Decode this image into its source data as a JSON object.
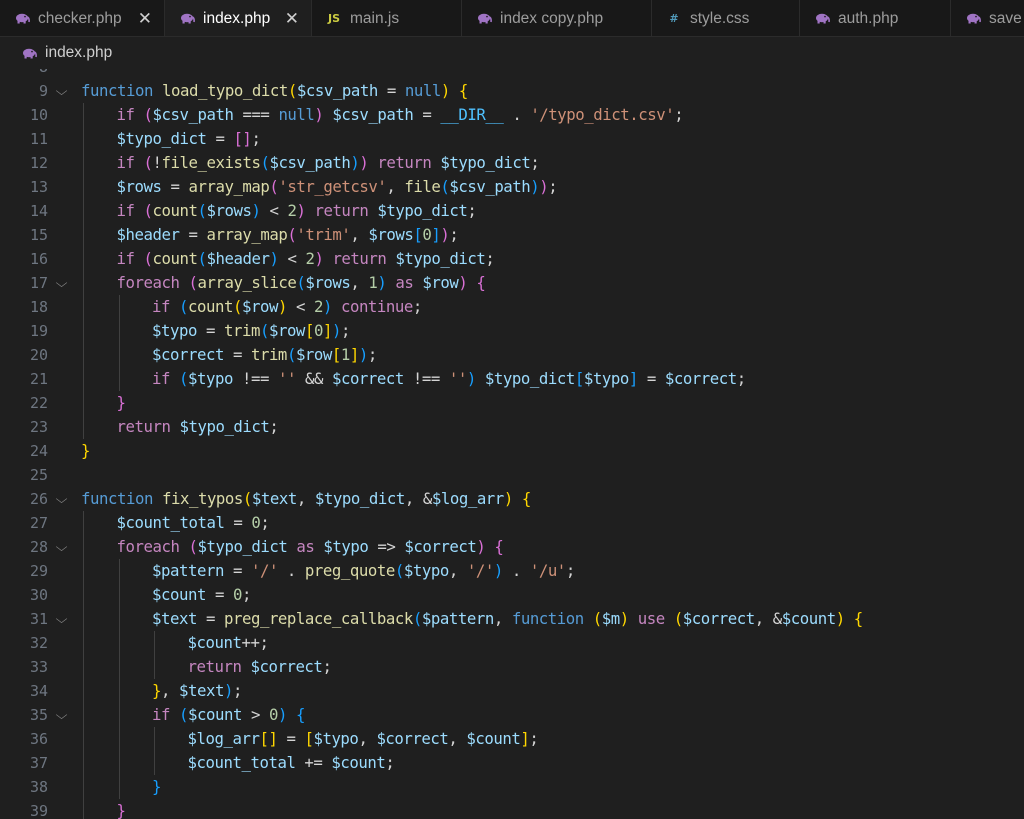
{
  "tabs": [
    {
      "label": "checker.php",
      "icon": "php-elephant-icon",
      "closable": true,
      "active": false
    },
    {
      "label": "index.php",
      "icon": "php-elephant-icon",
      "closable": true,
      "active": true
    },
    {
      "label": "main.js",
      "icon": "js-icon",
      "icon_text": "JS",
      "active": false
    },
    {
      "label": "index copy.php",
      "icon": "php-elephant-icon",
      "active": false
    },
    {
      "label": "style.css",
      "icon": "css-hash-icon",
      "icon_text": "#",
      "active": false
    },
    {
      "label": "auth.php",
      "icon": "php-elephant-icon",
      "active": false
    },
    {
      "label": "save",
      "icon": "php-elephant-icon",
      "active": false
    }
  ],
  "breadcrumb": {
    "file": "index.php",
    "icon": "php-elephant-icon"
  },
  "colors": {
    "editor_bg": "#1f1f1f",
    "tabbar_bg": "#181818",
    "keyword": "#c586c0",
    "storage": "#569cd6",
    "function": "#dcdcaa",
    "variable": "#9cdcfe",
    "string": "#ce9178",
    "number": "#b5cea8",
    "bracket1": "#ffd700",
    "bracket2": "#da70d6",
    "bracket3": "#179fff"
  },
  "code_lines": [
    {
      "n": "8",
      "fold": false,
      "indent": 0,
      "tokens": []
    },
    {
      "n": "9",
      "fold": true,
      "indent": 0,
      "tokens": [
        [
          "kwb",
          "function"
        ],
        [
          "op",
          " "
        ],
        [
          "fn",
          "load_typo_dict"
        ],
        [
          "bk1",
          "("
        ],
        [
          "var",
          "$csv_path"
        ],
        [
          "op",
          " = "
        ],
        [
          "kwb",
          "null"
        ],
        [
          "bk1",
          ")"
        ],
        [
          "op",
          " "
        ],
        [
          "bk1",
          "{"
        ]
      ]
    },
    {
      "n": "10",
      "fold": false,
      "indent": 1,
      "tokens": [
        [
          "kw",
          "if"
        ],
        [
          "op",
          " "
        ],
        [
          "bk2",
          "("
        ],
        [
          "var",
          "$csv_path"
        ],
        [
          "op",
          " === "
        ],
        [
          "kwb",
          "null"
        ],
        [
          "bk2",
          ")"
        ],
        [
          "op",
          " "
        ],
        [
          "var",
          "$csv_path"
        ],
        [
          "op",
          " = "
        ],
        [
          "cst",
          "__DIR__"
        ],
        [
          "op",
          " . "
        ],
        [
          "str",
          "'/typo_dict.csv'"
        ],
        [
          "op",
          ";"
        ]
      ]
    },
    {
      "n": "11",
      "fold": false,
      "indent": 1,
      "tokens": [
        [
          "var",
          "$typo_dict"
        ],
        [
          "op",
          " = "
        ],
        [
          "bk2",
          "[]"
        ],
        [
          "op",
          ";"
        ]
      ]
    },
    {
      "n": "12",
      "fold": false,
      "indent": 1,
      "tokens": [
        [
          "kw",
          "if"
        ],
        [
          "op",
          " "
        ],
        [
          "bk2",
          "("
        ],
        [
          "op",
          "!"
        ],
        [
          "fn",
          "file_exists"
        ],
        [
          "bk3",
          "("
        ],
        [
          "var",
          "$csv_path"
        ],
        [
          "bk3",
          ")"
        ],
        [
          "bk2",
          ")"
        ],
        [
          "op",
          " "
        ],
        [
          "kw",
          "return"
        ],
        [
          "op",
          " "
        ],
        [
          "var",
          "$typo_dict"
        ],
        [
          "op",
          ";"
        ]
      ]
    },
    {
      "n": "13",
      "fold": false,
      "indent": 1,
      "tokens": [
        [
          "var",
          "$rows"
        ],
        [
          "op",
          " = "
        ],
        [
          "fn",
          "array_map"
        ],
        [
          "bk2",
          "("
        ],
        [
          "str",
          "'str_getcsv'"
        ],
        [
          "op",
          ", "
        ],
        [
          "fn",
          "file"
        ],
        [
          "bk3",
          "("
        ],
        [
          "var",
          "$csv_path"
        ],
        [
          "bk3",
          ")"
        ],
        [
          "bk2",
          ")"
        ],
        [
          "op",
          ";"
        ]
      ]
    },
    {
      "n": "14",
      "fold": false,
      "indent": 1,
      "tokens": [
        [
          "kw",
          "if"
        ],
        [
          "op",
          " "
        ],
        [
          "bk2",
          "("
        ],
        [
          "fn",
          "count"
        ],
        [
          "bk3",
          "("
        ],
        [
          "var",
          "$rows"
        ],
        [
          "bk3",
          ")"
        ],
        [
          "op",
          " < "
        ],
        [
          "num",
          "2"
        ],
        [
          "bk2",
          ")"
        ],
        [
          "op",
          " "
        ],
        [
          "kw",
          "return"
        ],
        [
          "op",
          " "
        ],
        [
          "var",
          "$typo_dict"
        ],
        [
          "op",
          ";"
        ]
      ]
    },
    {
      "n": "15",
      "fold": false,
      "indent": 1,
      "tokens": [
        [
          "var",
          "$header"
        ],
        [
          "op",
          " = "
        ],
        [
          "fn",
          "array_map"
        ],
        [
          "bk2",
          "("
        ],
        [
          "str",
          "'trim'"
        ],
        [
          "op",
          ", "
        ],
        [
          "var",
          "$rows"
        ],
        [
          "bk3",
          "["
        ],
        [
          "num",
          "0"
        ],
        [
          "bk3",
          "]"
        ],
        [
          "bk2",
          ")"
        ],
        [
          "op",
          ";"
        ]
      ]
    },
    {
      "n": "16",
      "fold": false,
      "indent": 1,
      "tokens": [
        [
          "kw",
          "if"
        ],
        [
          "op",
          " "
        ],
        [
          "bk2",
          "("
        ],
        [
          "fn",
          "count"
        ],
        [
          "bk3",
          "("
        ],
        [
          "var",
          "$header"
        ],
        [
          "bk3",
          ")"
        ],
        [
          "op",
          " < "
        ],
        [
          "num",
          "2"
        ],
        [
          "bk2",
          ")"
        ],
        [
          "op",
          " "
        ],
        [
          "kw",
          "return"
        ],
        [
          "op",
          " "
        ],
        [
          "var",
          "$typo_dict"
        ],
        [
          "op",
          ";"
        ]
      ]
    },
    {
      "n": "17",
      "fold": true,
      "indent": 1,
      "tokens": [
        [
          "kw",
          "foreach"
        ],
        [
          "op",
          " "
        ],
        [
          "bk2",
          "("
        ],
        [
          "fn",
          "array_slice"
        ],
        [
          "bk3",
          "("
        ],
        [
          "var",
          "$rows"
        ],
        [
          "op",
          ", "
        ],
        [
          "num",
          "1"
        ],
        [
          "bk3",
          ")"
        ],
        [
          "op",
          " "
        ],
        [
          "kw",
          "as"
        ],
        [
          "op",
          " "
        ],
        [
          "var",
          "$row"
        ],
        [
          "bk2",
          ")"
        ],
        [
          "op",
          " "
        ],
        [
          "bk2",
          "{"
        ]
      ]
    },
    {
      "n": "18",
      "fold": false,
      "indent": 2,
      "tokens": [
        [
          "kw",
          "if"
        ],
        [
          "op",
          " "
        ],
        [
          "bk3",
          "("
        ],
        [
          "fn",
          "count"
        ],
        [
          "bk1",
          "("
        ],
        [
          "var",
          "$row"
        ],
        [
          "bk1",
          ")"
        ],
        [
          "op",
          " < "
        ],
        [
          "num",
          "2"
        ],
        [
          "bk3",
          ")"
        ],
        [
          "op",
          " "
        ],
        [
          "kw",
          "continue"
        ],
        [
          "op",
          ";"
        ]
      ]
    },
    {
      "n": "19",
      "fold": false,
      "indent": 2,
      "tokens": [
        [
          "var",
          "$typo"
        ],
        [
          "op",
          " = "
        ],
        [
          "fn",
          "trim"
        ],
        [
          "bk3",
          "("
        ],
        [
          "var",
          "$row"
        ],
        [
          "bk1",
          "["
        ],
        [
          "num",
          "0"
        ],
        [
          "bk1",
          "]"
        ],
        [
          "bk3",
          ")"
        ],
        [
          "op",
          ";"
        ]
      ]
    },
    {
      "n": "20",
      "fold": false,
      "indent": 2,
      "tokens": [
        [
          "var",
          "$correct"
        ],
        [
          "op",
          " = "
        ],
        [
          "fn",
          "trim"
        ],
        [
          "bk3",
          "("
        ],
        [
          "var",
          "$row"
        ],
        [
          "bk1",
          "["
        ],
        [
          "num",
          "1"
        ],
        [
          "bk1",
          "]"
        ],
        [
          "bk3",
          ")"
        ],
        [
          "op",
          ";"
        ]
      ]
    },
    {
      "n": "21",
      "fold": false,
      "indent": 2,
      "tokens": [
        [
          "kw",
          "if"
        ],
        [
          "op",
          " "
        ],
        [
          "bk3",
          "("
        ],
        [
          "var",
          "$typo"
        ],
        [
          "op",
          " !== "
        ],
        [
          "str",
          "''"
        ],
        [
          "op",
          " && "
        ],
        [
          "var",
          "$correct"
        ],
        [
          "op",
          " !== "
        ],
        [
          "str",
          "''"
        ],
        [
          "bk3",
          ")"
        ],
        [
          "op",
          " "
        ],
        [
          "var",
          "$typo_dict"
        ],
        [
          "bk3",
          "["
        ],
        [
          "var",
          "$typo"
        ],
        [
          "bk3",
          "]"
        ],
        [
          "op",
          " = "
        ],
        [
          "var",
          "$correct"
        ],
        [
          "op",
          ";"
        ]
      ]
    },
    {
      "n": "22",
      "fold": false,
      "indent": 1,
      "tokens": [
        [
          "bk2",
          "}"
        ]
      ]
    },
    {
      "n": "23",
      "fold": false,
      "indent": 1,
      "tokens": [
        [
          "kw",
          "return"
        ],
        [
          "op",
          " "
        ],
        [
          "var",
          "$typo_dict"
        ],
        [
          "op",
          ";"
        ]
      ]
    },
    {
      "n": "24",
      "fold": false,
      "indent": 0,
      "tokens": [
        [
          "bk1",
          "}"
        ]
      ]
    },
    {
      "n": "25",
      "fold": false,
      "indent": 0,
      "tokens": []
    },
    {
      "n": "26",
      "fold": true,
      "indent": 0,
      "tokens": [
        [
          "kwb",
          "function"
        ],
        [
          "op",
          " "
        ],
        [
          "fn",
          "fix_typos"
        ],
        [
          "bk1",
          "("
        ],
        [
          "var",
          "$text"
        ],
        [
          "op",
          ", "
        ],
        [
          "var",
          "$typo_dict"
        ],
        [
          "op",
          ", &"
        ],
        [
          "var",
          "$log_arr"
        ],
        [
          "bk1",
          ")"
        ],
        [
          "op",
          " "
        ],
        [
          "bk1",
          "{"
        ]
      ]
    },
    {
      "n": "27",
      "fold": false,
      "indent": 1,
      "tokens": [
        [
          "var",
          "$count_total"
        ],
        [
          "op",
          " = "
        ],
        [
          "num",
          "0"
        ],
        [
          "op",
          ";"
        ]
      ]
    },
    {
      "n": "28",
      "fold": true,
      "indent": 1,
      "tokens": [
        [
          "kw",
          "foreach"
        ],
        [
          "op",
          " "
        ],
        [
          "bk2",
          "("
        ],
        [
          "var",
          "$typo_dict"
        ],
        [
          "op",
          " "
        ],
        [
          "kw",
          "as"
        ],
        [
          "op",
          " "
        ],
        [
          "var",
          "$typo"
        ],
        [
          "op",
          " => "
        ],
        [
          "var",
          "$correct"
        ],
        [
          "bk2",
          ")"
        ],
        [
          "op",
          " "
        ],
        [
          "bk2",
          "{"
        ]
      ]
    },
    {
      "n": "29",
      "fold": false,
      "indent": 2,
      "tokens": [
        [
          "var",
          "$pattern"
        ],
        [
          "op",
          " = "
        ],
        [
          "str",
          "'/'"
        ],
        [
          "op",
          " . "
        ],
        [
          "fn",
          "preg_quote"
        ],
        [
          "bk3",
          "("
        ],
        [
          "var",
          "$typo"
        ],
        [
          "op",
          ", "
        ],
        [
          "str",
          "'/'"
        ],
        [
          "bk3",
          ")"
        ],
        [
          "op",
          " . "
        ],
        [
          "str",
          "'/u'"
        ],
        [
          "op",
          ";"
        ]
      ]
    },
    {
      "n": "30",
      "fold": false,
      "indent": 2,
      "tokens": [
        [
          "var",
          "$count"
        ],
        [
          "op",
          " = "
        ],
        [
          "num",
          "0"
        ],
        [
          "op",
          ";"
        ]
      ]
    },
    {
      "n": "31",
      "fold": true,
      "indent": 2,
      "tokens": [
        [
          "var",
          "$text"
        ],
        [
          "op",
          " = "
        ],
        [
          "fn",
          "preg_replace_callback"
        ],
        [
          "bk3",
          "("
        ],
        [
          "var",
          "$pattern"
        ],
        [
          "op",
          ", "
        ],
        [
          "kwb",
          "function"
        ],
        [
          "op",
          " "
        ],
        [
          "bk1",
          "("
        ],
        [
          "var",
          "$m"
        ],
        [
          "bk1",
          ")"
        ],
        [
          "op",
          " "
        ],
        [
          "kw",
          "use"
        ],
        [
          "op",
          " "
        ],
        [
          "bk1",
          "("
        ],
        [
          "var",
          "$correct"
        ],
        [
          "op",
          ", &"
        ],
        [
          "var",
          "$count"
        ],
        [
          "bk1",
          ")"
        ],
        [
          "op",
          " "
        ],
        [
          "bk1",
          "{"
        ]
      ]
    },
    {
      "n": "32",
      "fold": false,
      "indent": 3,
      "tokens": [
        [
          "var",
          "$count"
        ],
        [
          "op",
          "++;"
        ]
      ]
    },
    {
      "n": "33",
      "fold": false,
      "indent": 3,
      "tokens": [
        [
          "kw",
          "return"
        ],
        [
          "op",
          " "
        ],
        [
          "var",
          "$correct"
        ],
        [
          "op",
          ";"
        ]
      ]
    },
    {
      "n": "34",
      "fold": false,
      "indent": 2,
      "tokens": [
        [
          "bk1",
          "}"
        ],
        [
          "op",
          ", "
        ],
        [
          "var",
          "$text"
        ],
        [
          "bk3",
          ")"
        ],
        [
          "op",
          ";"
        ]
      ]
    },
    {
      "n": "35",
      "fold": true,
      "indent": 2,
      "tokens": [
        [
          "kw",
          "if"
        ],
        [
          "op",
          " "
        ],
        [
          "bk3",
          "("
        ],
        [
          "var",
          "$count"
        ],
        [
          "op",
          " > "
        ],
        [
          "num",
          "0"
        ],
        [
          "bk3",
          ")"
        ],
        [
          "op",
          " "
        ],
        [
          "bk3",
          "{"
        ]
      ]
    },
    {
      "n": "36",
      "fold": false,
      "indent": 3,
      "tokens": [
        [
          "var",
          "$log_arr"
        ],
        [
          "bk1",
          "[]"
        ],
        [
          "op",
          " = "
        ],
        [
          "bk1",
          "["
        ],
        [
          "var",
          "$typo"
        ],
        [
          "op",
          ", "
        ],
        [
          "var",
          "$correct"
        ],
        [
          "op",
          ", "
        ],
        [
          "var",
          "$count"
        ],
        [
          "bk1",
          "]"
        ],
        [
          "op",
          ";"
        ]
      ]
    },
    {
      "n": "37",
      "fold": false,
      "indent": 3,
      "tokens": [
        [
          "var",
          "$count_total"
        ],
        [
          "op",
          " += "
        ],
        [
          "var",
          "$count"
        ],
        [
          "op",
          ";"
        ]
      ]
    },
    {
      "n": "38",
      "fold": false,
      "indent": 2,
      "tokens": [
        [
          "bk3",
          "}"
        ]
      ]
    },
    {
      "n": "39",
      "fold": false,
      "indent": 1,
      "tokens": [
        [
          "bk2",
          "}"
        ]
      ]
    }
  ]
}
